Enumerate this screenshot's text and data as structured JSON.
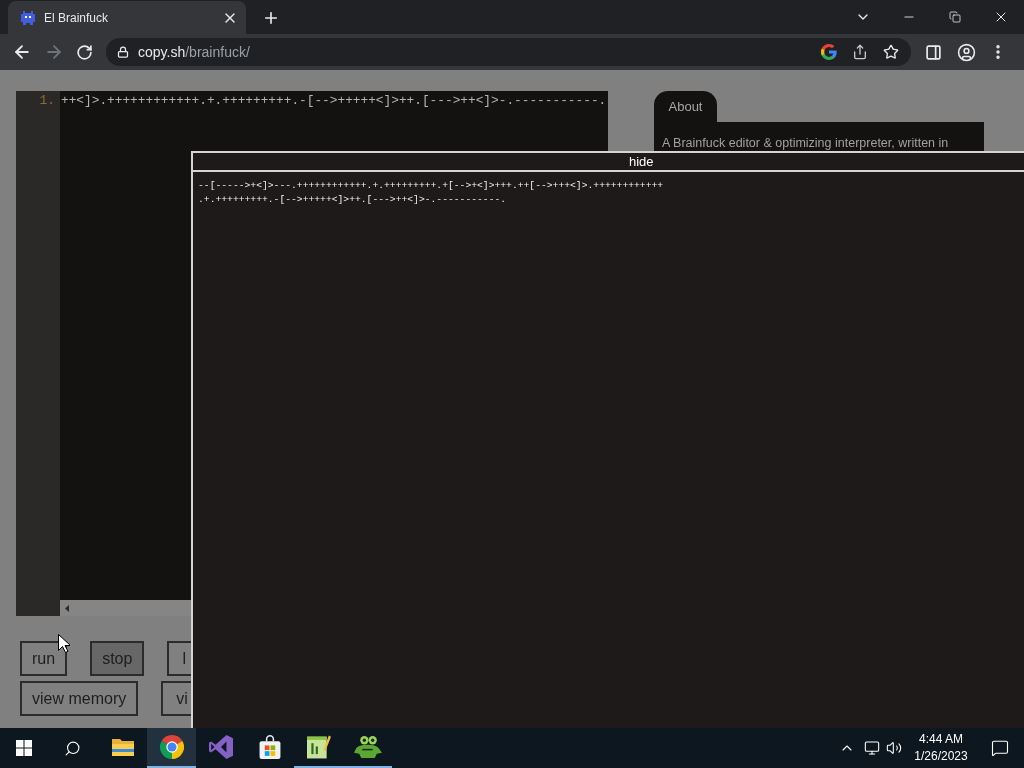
{
  "browser": {
    "tabs": [
      {
        "title": "El Brainfuck",
        "selected": true
      }
    ],
    "nav": {
      "back": {
        "disabled": false
      },
      "forward": {
        "disabled": true
      }
    },
    "address": {
      "host": "copy.sh",
      "path": "/brainfuck/"
    }
  },
  "editor": {
    "lines": [
      {
        "number": "1.",
        "code": "++<]>.++++++++++++.+.+++++++++.-[-->+++++<]>++.[--->++<]>-.-----------."
      }
    ]
  },
  "button_rows": [
    {
      "buttons": [
        {
          "label": "run",
          "active": false
        },
        {
          "label": "stop",
          "active": true
        },
        {
          "label": "l",
          "active": false
        }
      ]
    },
    {
      "buttons": [
        {
          "label": "view memory",
          "active": false
        },
        {
          "label": "vi",
          "active": false
        }
      ]
    }
  ],
  "about": {
    "tab": "About",
    "text": "A Brainfuck editor & optimizing interpreter, written in"
  },
  "output": {
    "toggle": "hide",
    "lines": [
      "--[----->+<]>---.++++++++++++.+.+++++++++.+[-->+<]>+++.++[-->+++<]>.++++++++++++",
      ".+.+++++++++.-[-->+++++<]>++.[--->++<]>-.-----------."
    ]
  },
  "taskbar": {
    "apps": [
      {
        "kind": "explorer",
        "running": false,
        "selected": false
      },
      {
        "kind": "chrome",
        "running": true,
        "selected": true
      },
      {
        "kind": "visualstudio",
        "running": false,
        "selected": false
      },
      {
        "kind": "store",
        "running": false,
        "selected": false
      },
      {
        "kind": "notepad",
        "running": true,
        "selected": false
      },
      {
        "kind": "frog",
        "running": true,
        "selected": false
      }
    ],
    "clock": {
      "time": "4:44 AM",
      "date": "1/26/2023"
    }
  }
}
